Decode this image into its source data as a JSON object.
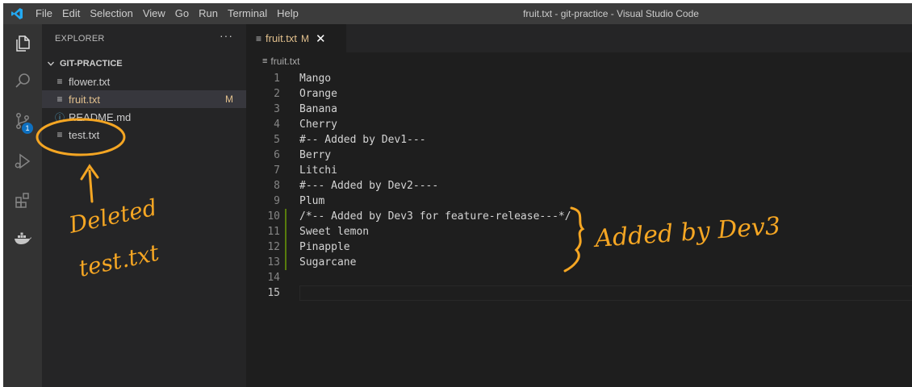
{
  "titlebar": {
    "menu": [
      "File",
      "Edit",
      "Selection",
      "View",
      "Go",
      "Run",
      "Terminal",
      "Help"
    ],
    "window_title": "fruit.txt - git-practice - Visual Studio Code"
  },
  "activity": {
    "icons": [
      "files-icon",
      "search-icon",
      "source-control-icon",
      "run-debug-icon",
      "extensions-icon",
      "docker-icon"
    ],
    "scm_badge": "1"
  },
  "sidebar": {
    "header": "EXPLORER",
    "more": "···",
    "folder": "GIT-PRACTICE",
    "files": [
      {
        "name": "flower.txt",
        "icon": "lines-icon",
        "status": "",
        "color": "#cccccc"
      },
      {
        "name": "fruit.txt",
        "icon": "lines-icon",
        "status": "M",
        "color": "#e2c08d"
      },
      {
        "name": "README.md",
        "icon": "info-icon",
        "status": "",
        "color": "#cccccc"
      },
      {
        "name": "test.txt",
        "icon": "lines-icon",
        "status": "",
        "color": "#cccccc"
      }
    ]
  },
  "editor": {
    "tab": {
      "label": "fruit.txt",
      "modified": "M",
      "close": "✕"
    },
    "breadcrumb": "fruit.txt",
    "lines": [
      "Mango",
      "Orange",
      "Banana",
      "Cherry",
      "#-- Added by Dev1---",
      "Berry",
      "Litchi",
      "#--- Added by Dev2----",
      "Plum",
      "/*-- Added by Dev3 for feature-release---*/",
      "Sweet lemon",
      "Pinapple",
      "Sugarcane",
      "",
      ""
    ],
    "added_lines": [
      10,
      11,
      12,
      13
    ],
    "cursor_line": 15
  },
  "annotations": {
    "left_line1": "Deleted",
    "left_line2": "test.txt",
    "right": "Added by Dev3"
  },
  "colors": {
    "annotation": "#f5a623",
    "modified": "#e2c08d",
    "added_gutter": "#587c0c"
  }
}
